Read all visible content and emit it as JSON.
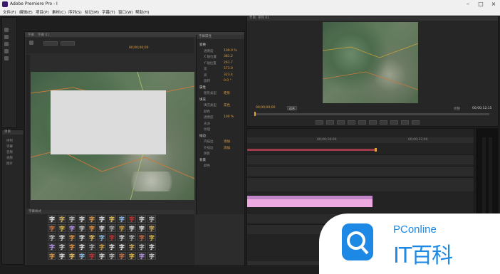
{
  "window": {
    "title": "Adobe Premiere Pro - I"
  },
  "menu": [
    "文件(F)",
    "编辑(E)",
    "项目(P)",
    "素材(C)",
    "序列(S)",
    "标记(M)",
    "字幕(T)",
    "窗口(W)",
    "帮助(H)"
  ],
  "titler": {
    "tabs": [
      "字幕",
      "字幕 01"
    ],
    "timecode": "00;00;00;00",
    "tab_props": "字幕属性",
    "tab_styles": "字幕样式",
    "props": [
      {
        "name": "变换",
        "type": "section"
      },
      {
        "name": "透明度",
        "value": "100.0 %"
      },
      {
        "name": "X 轴位置",
        "value": "381.2"
      },
      {
        "name": "Y 轴位置",
        "value": "261.7"
      },
      {
        "name": "宽",
        "value": "573.0"
      },
      {
        "name": "高",
        "value": "323.4"
      },
      {
        "name": "旋转",
        "value": "0.0 °"
      },
      {
        "name": "属性",
        "type": "section"
      },
      {
        "name": "图形类型",
        "value": "矩形"
      },
      {
        "name": "填充",
        "type": "section"
      },
      {
        "name": "填充类型",
        "value": "实色"
      },
      {
        "name": "颜色",
        "value": ""
      },
      {
        "name": "透明度",
        "value": "100 %"
      },
      {
        "name": "光泽",
        "value": ""
      },
      {
        "name": "纹理",
        "value": ""
      },
      {
        "name": "描边",
        "type": "section"
      },
      {
        "name": "内描边",
        "value": "添加"
      },
      {
        "name": "外描边",
        "value": "添加"
      },
      {
        "name": "阴影",
        "value": ""
      },
      {
        "name": "背景",
        "type": "section"
      },
      {
        "name": "颜色",
        "value": ""
      }
    ],
    "style_glyph": "字"
  },
  "program": {
    "tab": "节目: 序列 01",
    "timecode_left": "00;00;00;00",
    "fit": "适合",
    "full": "完整",
    "timecode_right": "00;00;12;15"
  },
  "timeline": {
    "ruler": [
      "00;00;16;00",
      "00;00;32;00"
    ]
  },
  "project": {
    "tab": "项目",
    "items": [
      "序列",
      "字幕",
      "音频",
      "视频",
      "图片"
    ]
  },
  "watermark": {
    "brand": "PConline",
    "name": "IT百科"
  },
  "colors": {
    "accent": "#e0a040",
    "clip_pink": "#f0a8e0",
    "brand_blue": "#1e88e5"
  }
}
